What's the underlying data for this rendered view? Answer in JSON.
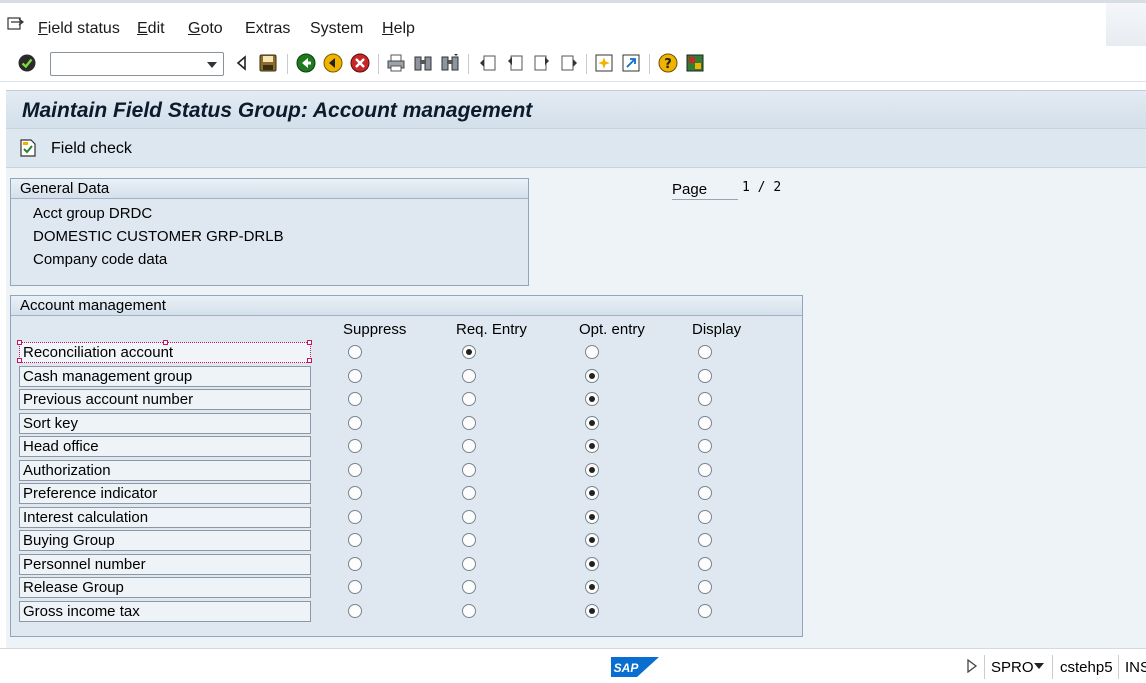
{
  "menu": {
    "items": [
      {
        "label_ul": "F",
        "label_rest": "ield status"
      },
      {
        "label_ul": "E",
        "label_rest": "dit"
      },
      {
        "label_ul": "G",
        "label_rest": "oto"
      },
      {
        "label_ul": "",
        "label_rest": "Extras"
      },
      {
        "label_ul": "",
        "label_rest": "System"
      },
      {
        "label_ul": "H",
        "label_rest": "elp"
      }
    ]
  },
  "toolbar": {
    "command_value": ""
  },
  "header": {
    "title": "Maintain Field Status Group: Account management"
  },
  "appbar": {
    "field_check_label": "Field check"
  },
  "general_data": {
    "title": "General Data",
    "acct_group": "Acct group   DRDC",
    "description": "DOMESTIC CUSTOMER GRP-DRLB",
    "subtitle": "Company code data"
  },
  "page": {
    "label": "Page",
    "current": "1",
    "separator": "/",
    "total": "2"
  },
  "account_management": {
    "title": "Account management",
    "columns": [
      "Suppress",
      "Req. Entry",
      "Opt. entry",
      "Display"
    ],
    "rows": [
      {
        "label": "Reconciliation account",
        "selected": 1
      },
      {
        "label": "Cash management group",
        "selected": 2
      },
      {
        "label": "Previous account number",
        "selected": 2
      },
      {
        "label": "Sort key",
        "selected": 2
      },
      {
        "label": "Head office",
        "selected": 2
      },
      {
        "label": "Authorization",
        "selected": 2
      },
      {
        "label": "Preference indicator",
        "selected": 2
      },
      {
        "label": "Interest calculation",
        "selected": 2
      },
      {
        "label": "Buying Group",
        "selected": 2
      },
      {
        "label": "Personnel number",
        "selected": 2
      },
      {
        "label": "Release Group",
        "selected": 2
      },
      {
        "label": "Gross income tax",
        "selected": 2
      }
    ]
  },
  "status": {
    "logo": "SAP",
    "transaction": "SPRO",
    "server": "cstehp5",
    "mode": "INS"
  },
  "colors": {
    "accent_green": "#1f8a1f",
    "accent_yellow": "#f0b400",
    "accent_red": "#c62828",
    "sap_blue": "#0a6ed1"
  }
}
